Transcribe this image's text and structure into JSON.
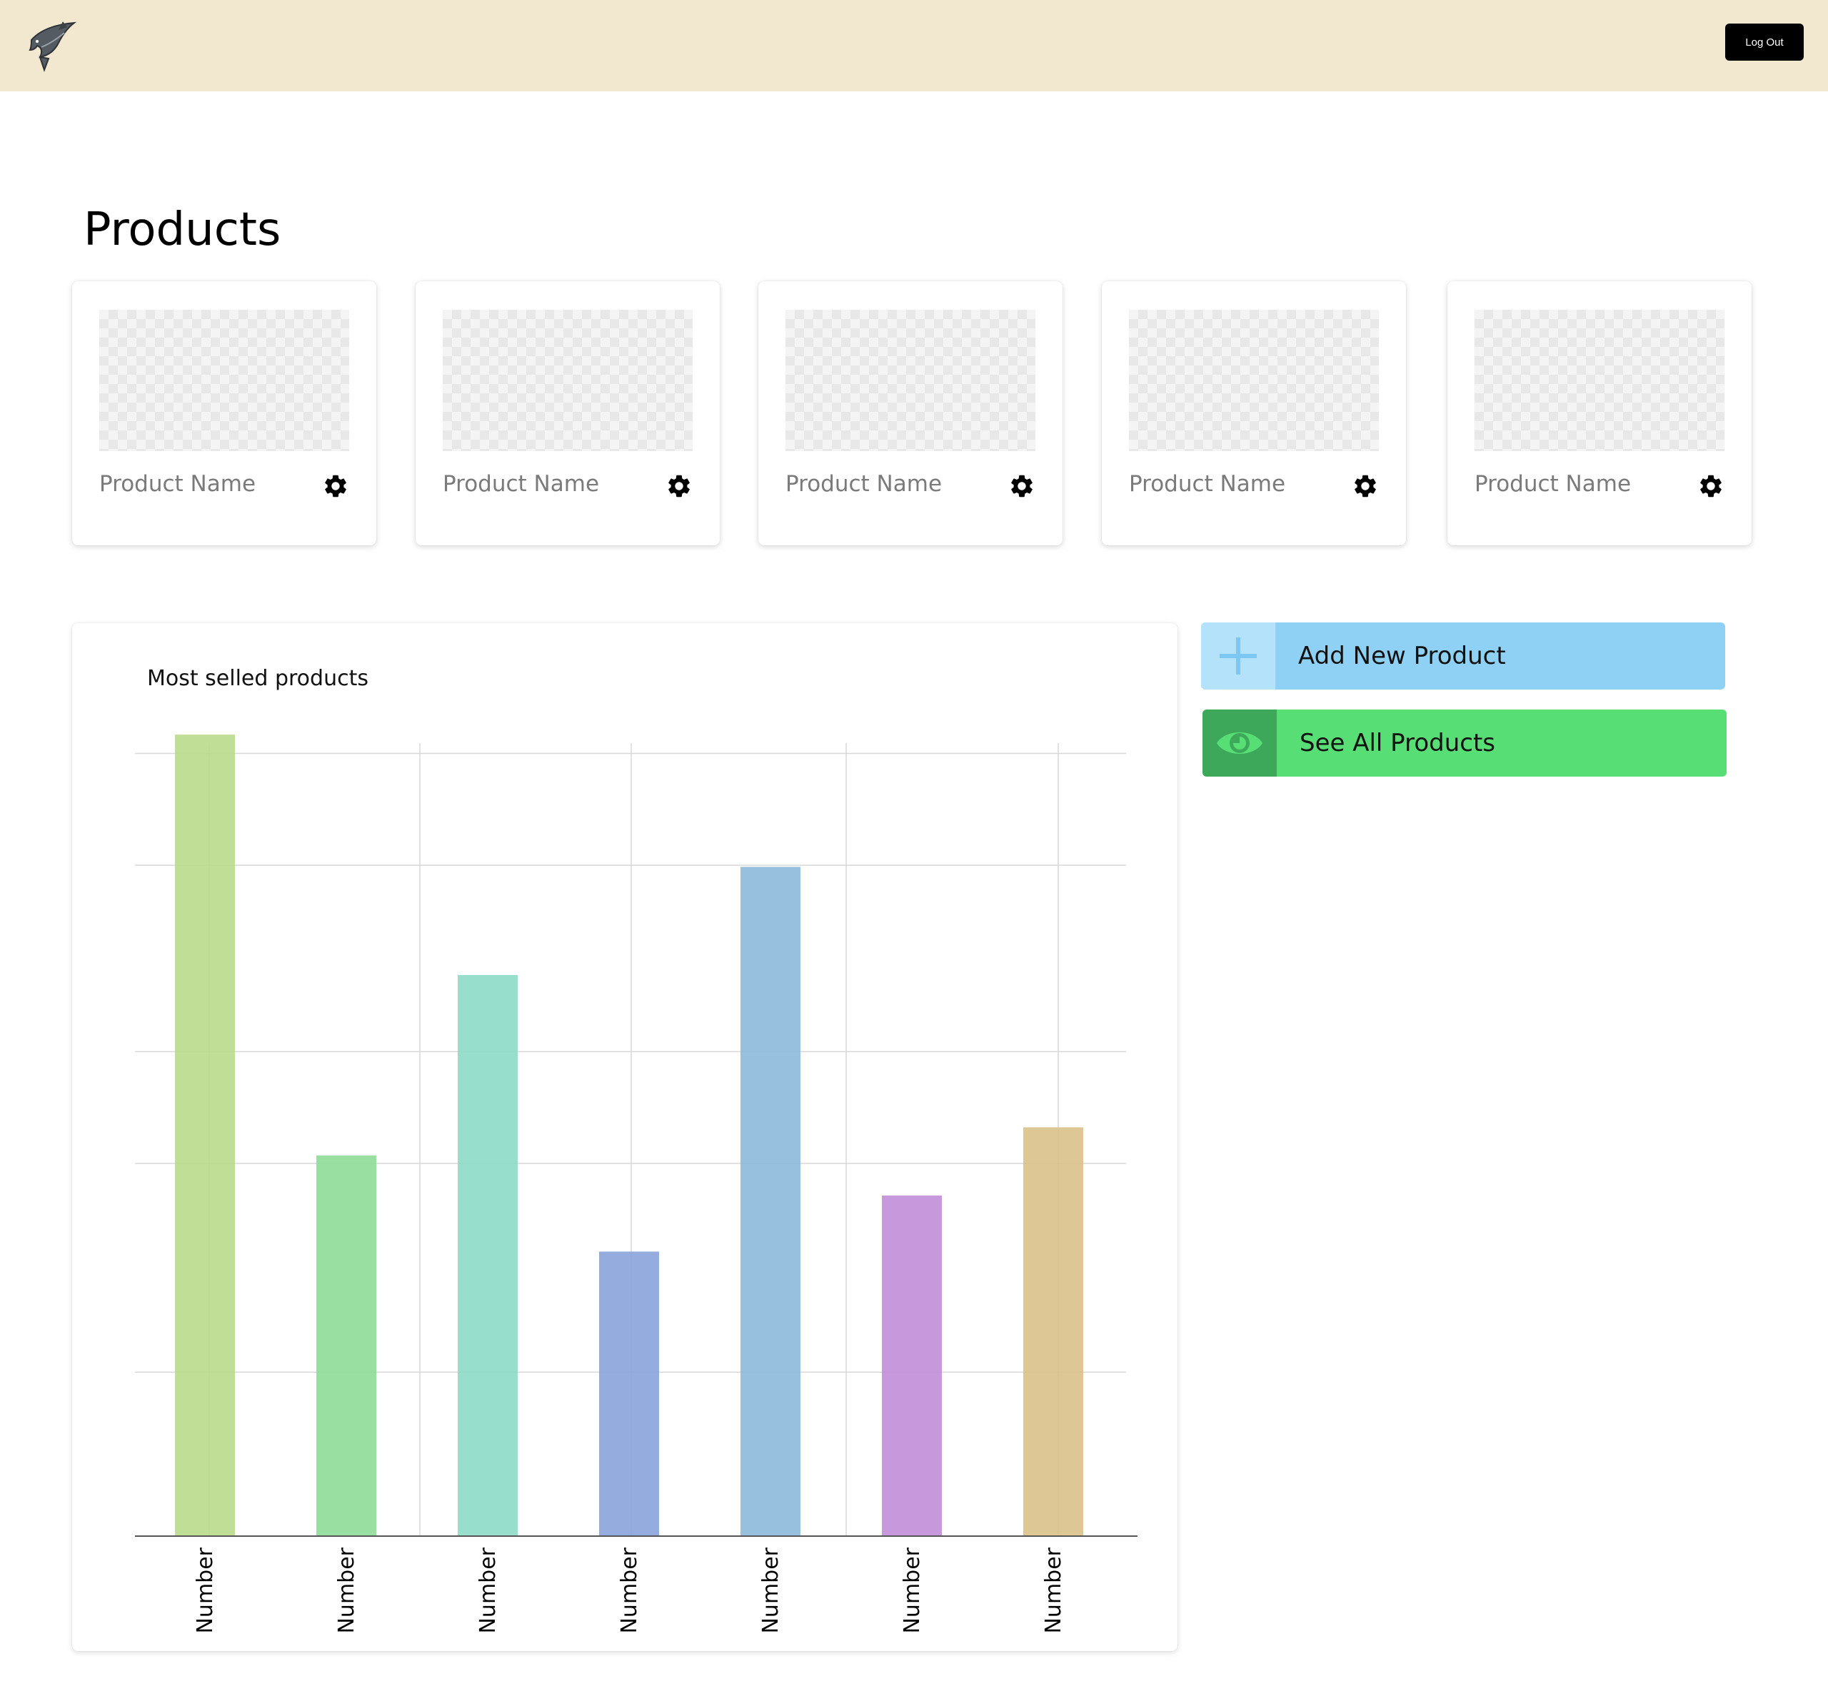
{
  "header": {
    "logo_icon": "leaping-fish-logo",
    "logout_label": "Log Out"
  },
  "page": {
    "title": "Products"
  },
  "products": [
    {
      "name": "Product Name",
      "icon": "gear-icon"
    },
    {
      "name": "Product Name",
      "icon": "gear-icon"
    },
    {
      "name": "Product Name",
      "icon": "gear-icon"
    },
    {
      "name": "Product Name",
      "icon": "gear-icon"
    },
    {
      "name": "Product Name",
      "icon": "gear-icon"
    }
  ],
  "actions": {
    "add_label": "Add New Product",
    "add_icon": "plus-icon",
    "see_label": "See All Products",
    "see_icon": "eye-icon"
  },
  "chart_data": {
    "type": "bar",
    "title": "Most selled products",
    "xlabel": "",
    "ylabel": "",
    "categories": [
      "Number",
      "Number",
      "Number",
      "Number",
      "Number",
      "Number",
      "Number"
    ],
    "values": [
      100,
      47.5,
      70,
      35.5,
      83.5,
      42.5,
      51
    ],
    "ylim": [
      0,
      105
    ],
    "grid": true,
    "colors": [
      "#b9da8a",
      "#8fdb98",
      "#8cdac8",
      "#8aa3da",
      "#8cb8da",
      "#c28dd8",
      "#d8c189"
    ]
  }
}
